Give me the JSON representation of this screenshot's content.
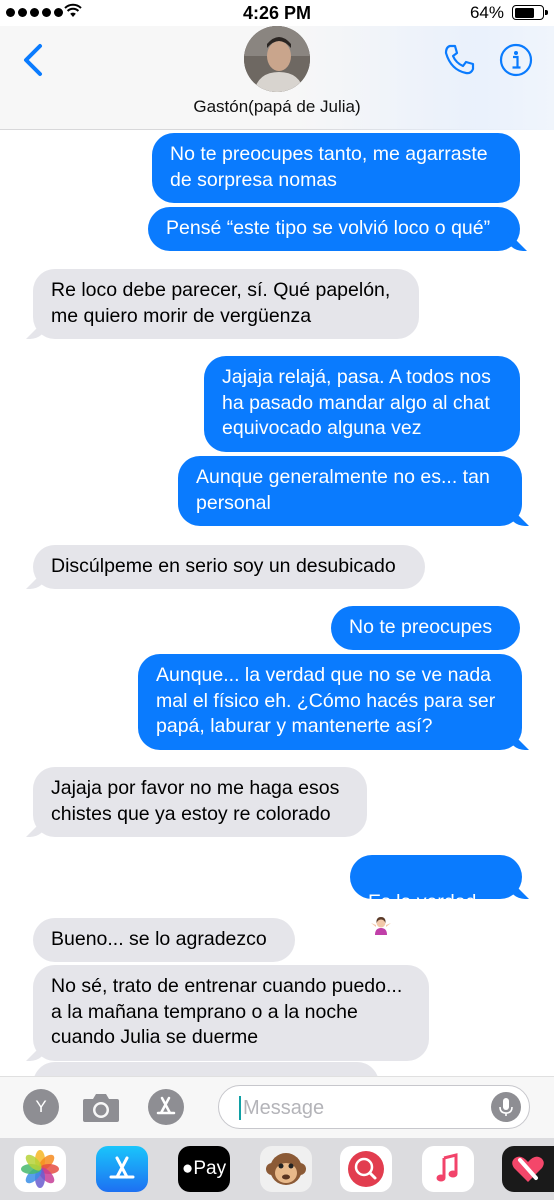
{
  "status_bar": {
    "time": "4:26 PM",
    "battery_text": "64%",
    "battery_level": 0.64,
    "signal_icon": "signal-dots-icon",
    "wifi_icon": "wifi-icon"
  },
  "header": {
    "contact_name": "Gastón(papá de Julia)",
    "back_icon": "chevron-left-icon",
    "call_icon": "phone-icon",
    "info_icon": "info-icon",
    "accent_color": "#0a7bfe"
  },
  "messages": [
    {
      "from": "me",
      "text": "No te preocupes tanto, me agarraste de sorpresa nomas"
    },
    {
      "from": "me",
      "text": "Pensé “este tipo se volvió loco o qué”"
    },
    {
      "from": "them",
      "text": "Re loco debe parecer, sí. Qué papelón, me quiero morir de vergüenza"
    },
    {
      "from": "me",
      "text": "Jajaja relajá, pasa. A todos nos ha pasado mandar algo al chat equivocado alguna vez"
    },
    {
      "from": "me",
      "text": "Aunque generalmente no es... tan personal"
    },
    {
      "from": "them",
      "text": "Discúlpeme en serio soy un desubicado"
    },
    {
      "from": "me",
      "text": "No te preocupes"
    },
    {
      "from": "me",
      "text": "Aunque... la verdad que no se ve nada mal el físico eh. ¿Cómo hacés para ser papá, laburar y mantenerte así?"
    },
    {
      "from": "them",
      "text": "Jajaja por favor no me haga esos chistes que ya estoy re colorado"
    },
    {
      "from": "me",
      "text": "Es la verdad",
      "emoji": "woman-shrugging-emoji"
    },
    {
      "from": "them",
      "text": "Bueno... se lo agradezco"
    },
    {
      "from": "them",
      "text": "No sé, trato de entrenar cuando puedo... a la mañana temprano o a la noche cuando Julia se duerme"
    }
  ],
  "input_bar": {
    "placeholder": "Message",
    "value": "",
    "y_button_label": "Y",
    "camera_icon": "camera-icon",
    "appstore_icon": "app-store-icon",
    "mic_icon": "microphone-icon"
  },
  "app_drawer": [
    {
      "name": "photos-app-icon"
    },
    {
      "name": "app-store-app-icon"
    },
    {
      "name": "apple-pay-app-icon",
      "label": "Pay"
    },
    {
      "name": "animoji-monkey-app-icon"
    },
    {
      "name": "web-images-search-app-icon"
    },
    {
      "name": "music-app-icon"
    },
    {
      "name": "digital-touch-app-icon"
    }
  ],
  "colors": {
    "outgoing_bubble": "#0a7bfe",
    "incoming_bubble": "#e5e5ea",
    "header_bg": "#f7f7f7"
  }
}
